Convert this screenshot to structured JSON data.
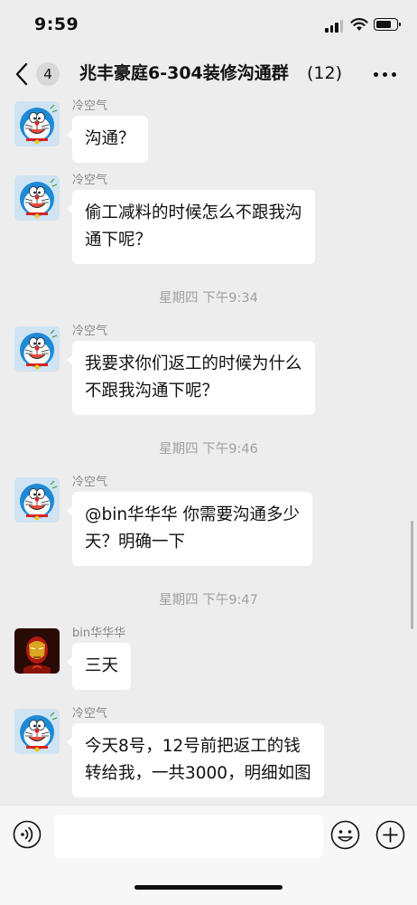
{
  "status_bar": {
    "time": "9:59"
  },
  "nav": {
    "unread_count": "4",
    "title": "兆丰豪庭6-304装修沟通群",
    "member_count": "(12)"
  },
  "messages": [
    {
      "sender": "冷空气",
      "avatar": "doraemon-avatar",
      "text": "沟通？"
    },
    {
      "sender": "冷空气",
      "avatar": "doraemon-avatar",
      "lines": [
        "偷工减料的时候怎么不跟我沟",
        "通下呢？"
      ]
    },
    {
      "timestamp": "星期四 下午9:34"
    },
    {
      "sender": "冷空气",
      "avatar": "doraemon-avatar",
      "lines": [
        "我要求你们返工的时候为什么",
        "不跟我沟通下呢？"
      ]
    },
    {
      "timestamp": "星期四 下午9:46"
    },
    {
      "sender": "冷空气",
      "avatar": "doraemon-avatar",
      "lines": [
        "@bin华华华 你需要沟通多少",
        "天？明确一下"
      ]
    },
    {
      "timestamp": "星期四 下午9:47"
    },
    {
      "sender": "bin华华华",
      "avatar": "iron-man-avatar",
      "text": "三天"
    },
    {
      "sender": "冷空气",
      "avatar": "doraemon-avatar",
      "lines": [
        "今天8号，12号前把返工的钱",
        "转给我，一共3000，明细如图"
      ]
    }
  ],
  "input_bar": {
    "voice_icon": "voice-icon",
    "emoji_icon": "emoji-icon",
    "add_icon": "plus-icon"
  },
  "colors": {
    "background": "#ededed",
    "bubble": "#ffffff",
    "timestamp": "#a0a0a0",
    "sender": "#888888"
  }
}
